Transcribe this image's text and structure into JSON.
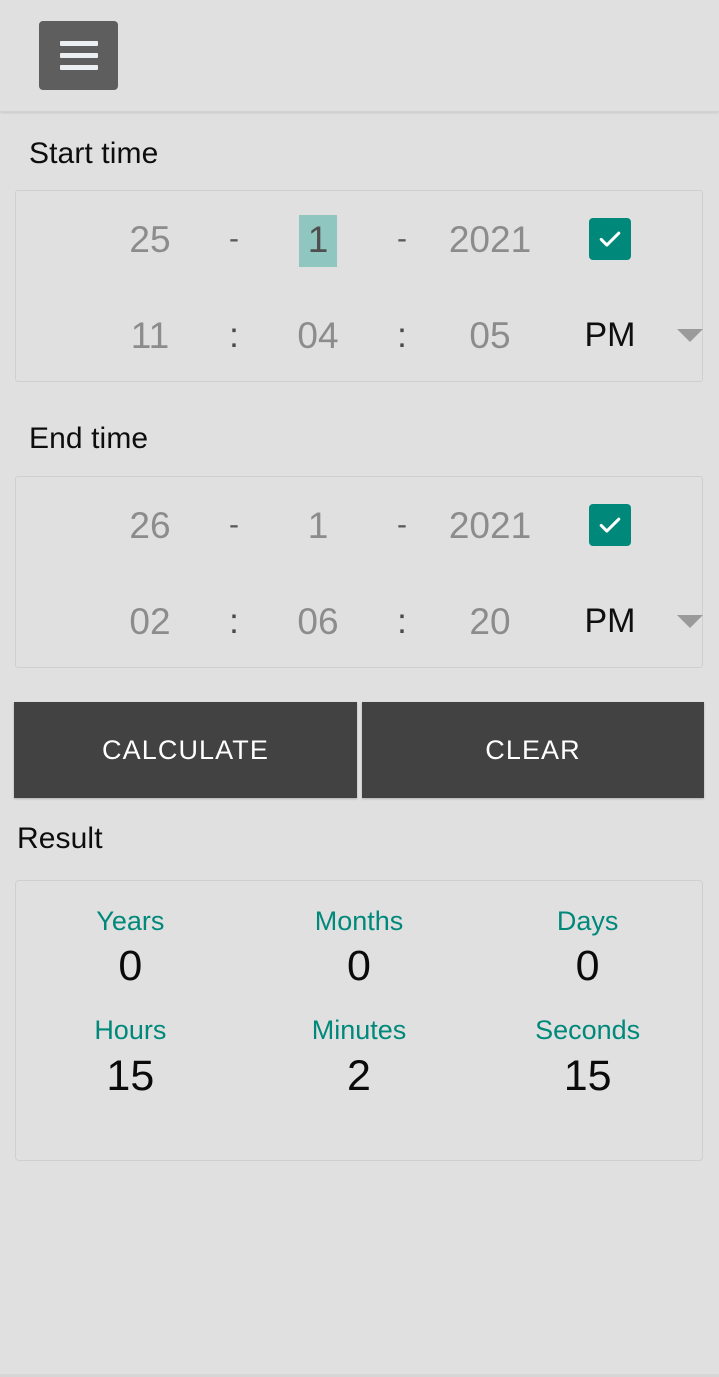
{
  "toolbar": {
    "menu_icon": "hamburger-menu-icon"
  },
  "start_section": {
    "label": "Start time",
    "date": {
      "day": "25",
      "separator1": "-",
      "month": "1",
      "separator2": "-",
      "year": "2021",
      "confirm_icon": "checkmark-icon",
      "month_highlighted": true
    },
    "time": {
      "hours": "11",
      "separator1": ":",
      "minutes": "04",
      "separator2": ":",
      "seconds": "05",
      "meridiem": "PM",
      "dropdown_icon": "chevron-down-icon"
    }
  },
  "end_section": {
    "label": "End time",
    "date": {
      "day": "26",
      "separator1": "-",
      "month": "1",
      "separator2": "-",
      "year": "2021",
      "confirm_icon": "checkmark-icon",
      "month_highlighted": false
    },
    "time": {
      "hours": "02",
      "separator1": ":",
      "minutes": "06",
      "separator2": ":",
      "seconds": "20",
      "meridiem": "PM",
      "dropdown_icon": "chevron-down-icon"
    }
  },
  "actions": {
    "calculate_label": "CALCULATE",
    "clear_label": "CLEAR"
  },
  "result_section": {
    "label": "Result",
    "row1": [
      {
        "label": "Years",
        "value": "0"
      },
      {
        "label": "Months",
        "value": "0"
      },
      {
        "label": "Days",
        "value": "0"
      }
    ],
    "row2": [
      {
        "label": "Hours",
        "value": "15"
      },
      {
        "label": "Minutes",
        "value": "2"
      },
      {
        "label": "Seconds",
        "value": "15"
      }
    ]
  },
  "colors": {
    "accent_teal": "#00897b",
    "highlight_teal": "#8fc7c0",
    "button_dark": "#424242",
    "background": "#e0e0e0",
    "menu_button": "#5e5e5e"
  }
}
